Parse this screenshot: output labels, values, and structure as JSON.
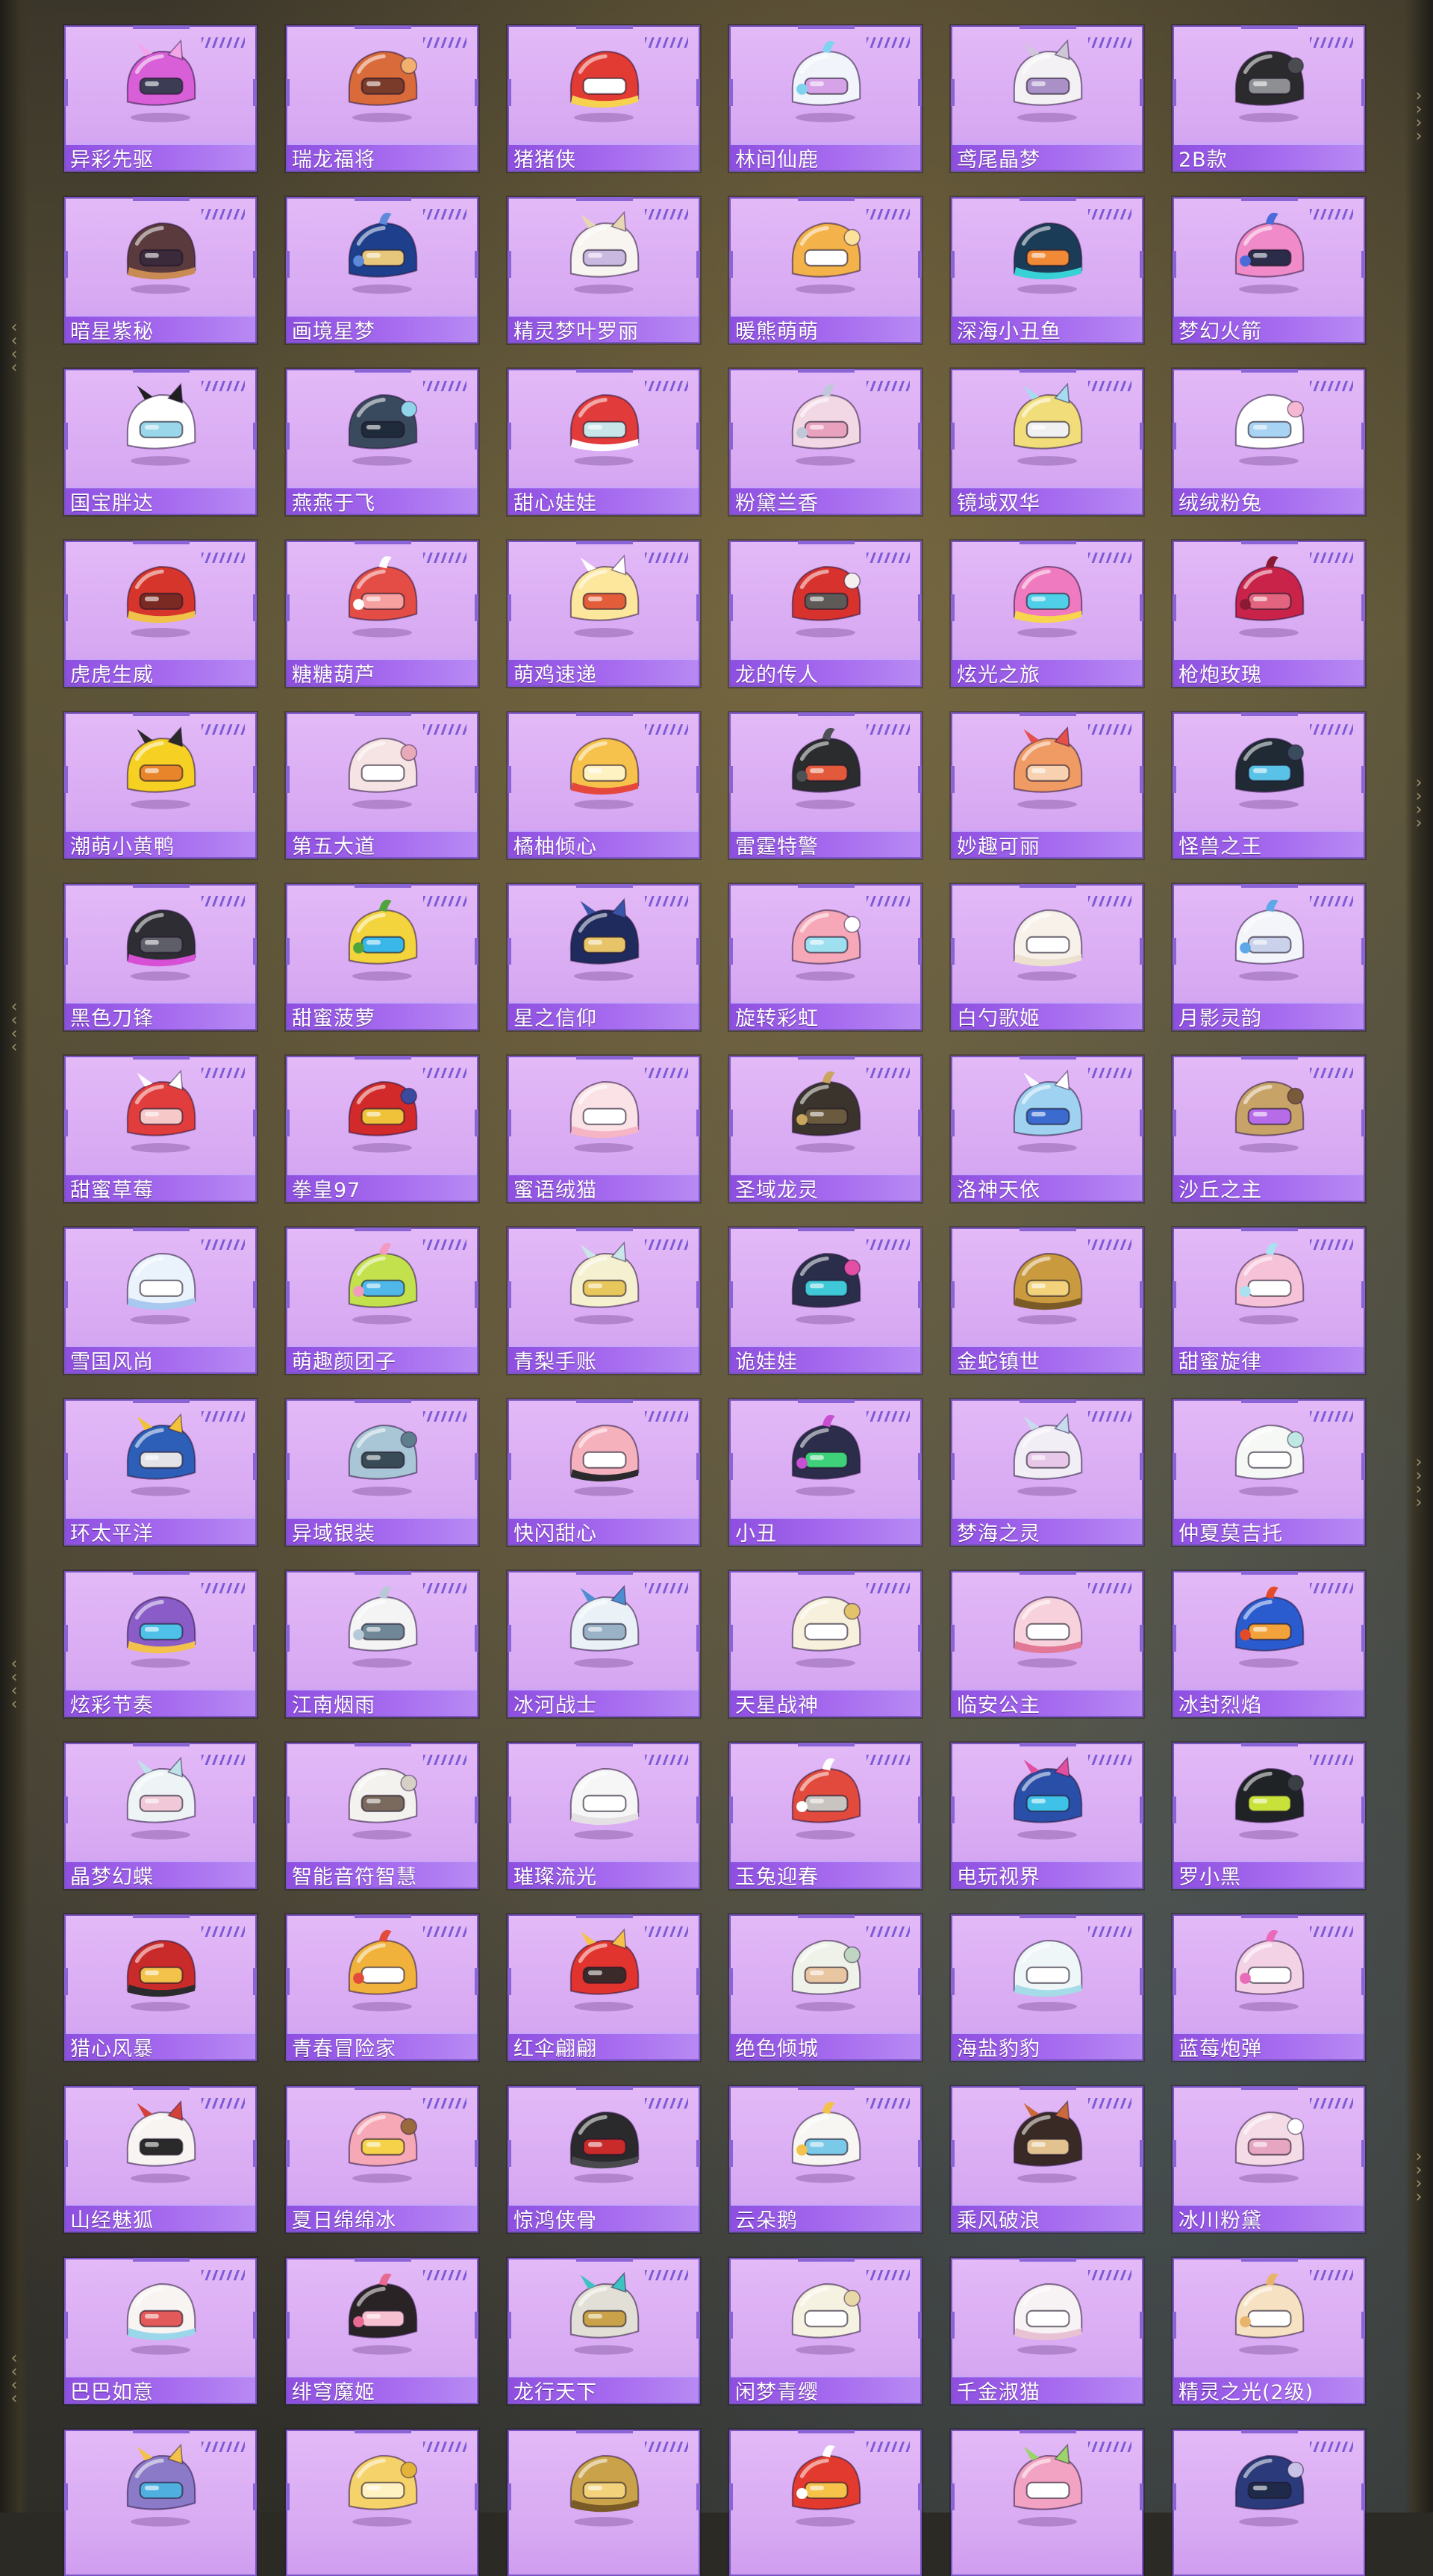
{
  "items": [
    {
      "name": "异彩先驱",
      "icon": "cyber-helmet-icon",
      "colors": [
        "#d85fd8",
        "#f2a5e8",
        "#3c3c55"
      ]
    },
    {
      "name": "瑞龙福将",
      "icon": "dragon-helmet-icon",
      "colors": [
        "#d96a3a",
        "#f1b06d",
        "#7a3b2a"
      ]
    },
    {
      "name": "猪猪侠",
      "icon": "pig-helmet-icon",
      "colors": [
        "#e23b33",
        "#f6d24f",
        "#ffffff"
      ]
    },
    {
      "name": "林间仙鹿",
      "icon": "deer-helmet-icon",
      "colors": [
        "#f1f4fb",
        "#7fd3ee",
        "#d6a3e8"
      ]
    },
    {
      "name": "鸢尾晶梦",
      "icon": "iris-helmet-icon",
      "colors": [
        "#f4f1f4",
        "#cfc6d8",
        "#a991c8"
      ]
    },
    {
      "name": "2B款",
      "icon": "black-helmet-icon",
      "colors": [
        "#2b2b2d",
        "#4a4c4f",
        "#8d8f92"
      ]
    },
    {
      "name": "暗星紫秘",
      "icon": "dark-star-helmet-icon",
      "colors": [
        "#5a3a3c",
        "#c98a54",
        "#3a2a3a"
      ]
    },
    {
      "name": "画境星梦",
      "icon": "painted-helmet-icon",
      "colors": [
        "#1d3f8c",
        "#5d8ad9",
        "#e7c77c"
      ]
    },
    {
      "name": "精灵梦叶罗丽",
      "icon": "fairy-helmet-icon",
      "colors": [
        "#f8f4f0",
        "#e7d6b4",
        "#c9b8e0"
      ]
    },
    {
      "name": "暖熊萌萌",
      "icon": "bear-helmet-icon",
      "colors": [
        "#f3b24a",
        "#fbe19b",
        "#ffffff"
      ]
    },
    {
      "name": "深海小丑鱼",
      "icon": "clownfish-helmet-icon",
      "colors": [
        "#1b3c57",
        "#37d1d6",
        "#f08a36"
      ]
    },
    {
      "name": "梦幻火箭",
      "icon": "rocket-helmet-icon",
      "colors": [
        "#f08ac8",
        "#4a6bd8",
        "#2b2b4a"
      ]
    },
    {
      "name": "国宝胖达",
      "icon": "panda-helmet-icon",
      "colors": [
        "#ffffff",
        "#1f1f22",
        "#9ad7ea"
      ]
    },
    {
      "name": "燕燕于飞",
      "icon": "swallow-helmet-icon",
      "colors": [
        "#3a4a5e",
        "#8fd4e8",
        "#1f2a3a"
      ]
    },
    {
      "name": "甜心娃娃",
      "icon": "santa-helmet-icon",
      "colors": [
        "#e23b3b",
        "#ffffff",
        "#c8e6ea"
      ]
    },
    {
      "name": "粉黛兰香",
      "icon": "orchid-helmet-icon",
      "colors": [
        "#f2d7e4",
        "#bfc8d6",
        "#e9a2be"
      ]
    },
    {
      "name": "镜域双华",
      "icon": "mirror-helmet-icon",
      "colors": [
        "#f1dd7a",
        "#a5dcf0",
        "#f0f0f0"
      ]
    },
    {
      "name": "绒绒粉兔",
      "icon": "bunny-helmet-icon",
      "colors": [
        "#ffffff",
        "#f4b8d2",
        "#a9d3f2"
      ]
    },
    {
      "name": "虎虎生威",
      "icon": "tiger-helmet-icon",
      "colors": [
        "#d6352b",
        "#f0c24a",
        "#7a2a22"
      ]
    },
    {
      "name": "糖糖葫芦",
      "icon": "candied-haw-helmet-icon",
      "colors": [
        "#e44d45",
        "#ffffff",
        "#f6a0a0"
      ]
    },
    {
      "name": "萌鸡速递",
      "icon": "chick-helmet-icon",
      "colors": [
        "#fde79c",
        "#ffffff",
        "#e45d3b"
      ]
    },
    {
      "name": "龙的传人",
      "icon": "dragon-heir-helmet-icon",
      "colors": [
        "#d8322e",
        "#f3f0ee",
        "#5d5a58"
      ]
    },
    {
      "name": "炫光之旅",
      "icon": "neon-helmet-icon",
      "colors": [
        "#f07ac0",
        "#f7d54d",
        "#4fd0e8"
      ]
    },
    {
      "name": "枪炮玫瑰",
      "icon": "rose-helmet-icon",
      "colors": [
        "#c9234a",
        "#8a1a33",
        "#e2647e"
      ]
    },
    {
      "name": "潮萌小黄鸭",
      "icon": "duck-helmet-icon",
      "colors": [
        "#f6d124",
        "#2a2a2a",
        "#e8852b"
      ]
    },
    {
      "name": "第五大道",
      "icon": "fifth-avenue-helmet-icon",
      "colors": [
        "#f6e3e3",
        "#e8a9b8",
        "#ffffff"
      ]
    },
    {
      "name": "橘柚倾心",
      "icon": "citrus-helmet-icon",
      "colors": [
        "#f7c24b",
        "#e5473d",
        "#fff2c2"
      ]
    },
    {
      "name": "雷霆特警",
      "icon": "swat-helmet-icon",
      "colors": [
        "#2a2c2e",
        "#4e5256",
        "#e25a3b"
      ]
    },
    {
      "name": "妙趣可丽",
      "icon": "crepe-helmet-icon",
      "colors": [
        "#f09a64",
        "#e5504a",
        "#f8d2b0"
      ]
    },
    {
      "name": "怪兽之王",
      "icon": "kaiju-helmet-icon",
      "colors": [
        "#1f2a35",
        "#3a4b5e",
        "#59c2e6"
      ]
    },
    {
      "name": "黑色刀锋",
      "icon": "blade-helmet-icon",
      "colors": [
        "#2d2d33",
        "#d64fd5",
        "#5e5e68"
      ]
    },
    {
      "name": "甜蜜菠萝",
      "icon": "pineapple-helmet-icon",
      "colors": [
        "#f3d43c",
        "#4fa53b",
        "#38b7e8"
      ]
    },
    {
      "name": "星之信仰",
      "icon": "star-faith-helmet-icon",
      "colors": [
        "#1f2b5c",
        "#3a55a8",
        "#e7c468"
      ]
    },
    {
      "name": "旋转彩虹",
      "icon": "rainbow-helmet-icon",
      "colors": [
        "#f6a8b8",
        "#ffffff",
        "#9ee0f0"
      ]
    },
    {
      "name": "白勺歌姬",
      "icon": "singer-helmet-icon",
      "colors": [
        "#f7f1ea",
        "#ece0cf",
        "#ffffff"
      ]
    },
    {
      "name": "月影灵韵",
      "icon": "moon-helmet-icon",
      "colors": [
        "#f4f4fb",
        "#5ea8e8",
        "#c9d2ea"
      ]
    },
    {
      "name": "甜蜜草莓",
      "icon": "strawberry-helmet-icon",
      "colors": [
        "#e23d3d",
        "#ffffff",
        "#f6c8c8"
      ]
    },
    {
      "name": "拳皇97",
      "icon": "kof97-helmet-icon",
      "colors": [
        "#d22a2a",
        "#3b4a9e",
        "#f0c23a"
      ]
    },
    {
      "name": "蜜语绒猫",
      "icon": "plush-cat-helmet-icon",
      "colors": [
        "#fbe2e7",
        "#f5b5c4",
        "#ffffff"
      ]
    },
    {
      "name": "圣域龙灵",
      "icon": "sanctuary-dragon-helmet-icon",
      "colors": [
        "#3a342c",
        "#c9a55e",
        "#6a5a3e"
      ]
    },
    {
      "name": "洛神天依",
      "icon": "luo-tianyi-helmet-icon",
      "colors": [
        "#9fd2f0",
        "#ffffff",
        "#3b6bcf"
      ]
    },
    {
      "name": "沙丘之主",
      "icon": "dune-helmet-icon",
      "colors": [
        "#c8a368",
        "#7a5a3a",
        "#b66be8"
      ]
    },
    {
      "name": "雪国风尚",
      "icon": "snow-helmet-icon",
      "colors": [
        "#eaf2fb",
        "#a9c8ef",
        "#ffffff"
      ]
    },
    {
      "name": "萌趣颜团子",
      "icon": "dango-helmet-icon",
      "colors": [
        "#c3e14d",
        "#f29ac0",
        "#4fb8e8"
      ]
    },
    {
      "name": "青梨手账",
      "icon": "pear-helmet-icon",
      "colors": [
        "#f4f0d0",
        "#c9e6e9",
        "#e8c85c"
      ]
    },
    {
      "name": "诡娃娃",
      "icon": "creepy-doll-helmet-icon",
      "colors": [
        "#2a2e4a",
        "#e24fa5",
        "#3fc9d8"
      ]
    },
    {
      "name": "金蛇镇世",
      "icon": "golden-snake-helmet-icon",
      "colors": [
        "#c99a3e",
        "#7a5a26",
        "#f2d27a"
      ]
    },
    {
      "name": "甜蜜旋律",
      "icon": "melody-helmet-icon",
      "colors": [
        "#f6c2d8",
        "#a8e2f0",
        "#ffffff"
      ]
    },
    {
      "name": "环太平洋",
      "icon": "pacific-rim-helmet-icon",
      "colors": [
        "#2d5fb8",
        "#f2c23a",
        "#e4e4e8"
      ]
    },
    {
      "name": "异域银装",
      "icon": "silver-helmet-icon",
      "colors": [
        "#a9c6d6",
        "#5e7e8e",
        "#3a4b58"
      ]
    },
    {
      "name": "快闪甜心",
      "icon": "flash-sweet-helmet-icon",
      "colors": [
        "#f6b2bc",
        "#2b2b2d",
        "#ffffff"
      ]
    },
    {
      "name": "小丑",
      "icon": "joker-helmet-icon",
      "colors": [
        "#2b2d4a",
        "#c94fd2",
        "#3fd07a"
      ]
    },
    {
      "name": "梦海之灵",
      "icon": "dream-sea-helmet-icon",
      "colors": [
        "#f2eef6",
        "#c7dcef",
        "#e8c8e8"
      ]
    },
    {
      "name": "仲夏莫吉托",
      "icon": "mojito-helmet-icon",
      "colors": [
        "#f6f8f6",
        "#bfe7e3",
        "#ffffff"
      ]
    },
    {
      "name": "炫彩节奏",
      "icon": "rhythm-helmet-icon",
      "colors": [
        "#8a5cc8",
        "#f2c24a",
        "#4fc0e8"
      ]
    },
    {
      "name": "江南烟雨",
      "icon": "jiangnan-helmet-icon",
      "colors": [
        "#f4f4f4",
        "#b6c9d6",
        "#6f8796"
      ]
    },
    {
      "name": "冰河战士",
      "icon": "glacier-helmet-icon",
      "colors": [
        "#eaf2f8",
        "#4b8fd2",
        "#9ab2c6"
      ]
    },
    {
      "name": "天星战神",
      "icon": "star-god-helmet-icon",
      "colors": [
        "#f6f0dc",
        "#e2c26a",
        "#ffffff"
      ]
    },
    {
      "name": "临安公主",
      "icon": "princess-helmet-icon",
      "colors": [
        "#f7d2dc",
        "#e27896",
        "#ffffff"
      ]
    },
    {
      "name": "冰封烈焰",
      "icon": "frozen-flame-helmet-icon",
      "colors": [
        "#2a5cd0",
        "#e24a2a",
        "#f2a23a"
      ]
    },
    {
      "name": "晶梦幻蝶",
      "icon": "butterfly-helmet-icon",
      "colors": [
        "#eef4f6",
        "#bfe2e8",
        "#f0c8d8"
      ]
    },
    {
      "name": "智能音符智慧",
      "icon": "music-note-helmet-icon",
      "colors": [
        "#f4f2ee",
        "#d6d0c6",
        "#7a6a5e"
      ]
    },
    {
      "name": "璀璨流光",
      "icon": "radiant-helmet-icon",
      "colors": [
        "#f7f6f6",
        "#e4e0e4",
        "#ffffff"
      ]
    },
    {
      "name": "玉兔迎春",
      "icon": "jade-rabbit-helmet-icon",
      "colors": [
        "#e24a3e",
        "#ffffff",
        "#c9c4c0"
      ]
    },
    {
      "name": "电玩视界",
      "icon": "arcade-helmet-icon",
      "colors": [
        "#2a4fa8",
        "#e24fa0",
        "#3fc2e8"
      ]
    },
    {
      "name": "罗小黑",
      "icon": "black-cat-helmet-icon",
      "colors": [
        "#1f2326",
        "#3a3f44",
        "#c9e23a"
      ]
    },
    {
      "name": "猎心风暴",
      "icon": "storm-helmet-icon",
      "colors": [
        "#c92a2a",
        "#2b2b2d",
        "#f2c24a"
      ]
    },
    {
      "name": "青春冒险家",
      "icon": "adventurer-helmet-icon",
      "colors": [
        "#f0b23a",
        "#e24a3a",
        "#ffffff"
      ]
    },
    {
      "name": "红伞翩翩",
      "icon": "umbrella-helmet-icon",
      "colors": [
        "#e2342e",
        "#f6c24a",
        "#3a2a2a"
      ]
    },
    {
      "name": "绝色倾城",
      "icon": "beauty-helmet-icon",
      "colors": [
        "#eef2e8",
        "#bfd6c2",
        "#e8c6a2"
      ]
    },
    {
      "name": "海盐豹豹",
      "icon": "sea-salt-leopard-helmet-icon",
      "colors": [
        "#eef6f8",
        "#a6dce8",
        "#ffffff"
      ]
    },
    {
      "name": "蓝莓炮弹",
      "icon": "blueberry-helmet-icon",
      "colors": [
        "#f4d2e6",
        "#e86ab8",
        "#ffffff"
      ]
    },
    {
      "name": "山经魅狐",
      "icon": "fox-mask-helmet-icon",
      "colors": [
        "#f7f4f2",
        "#d2423a",
        "#2a2a2a"
      ]
    },
    {
      "name": "夏日绵绵冰",
      "icon": "shaved-ice-helmet-icon",
      "colors": [
        "#f6a8b6",
        "#9a6a3e",
        "#f6d24a"
      ]
    },
    {
      "name": "惊鸿侠骨",
      "icon": "swordsman-helmet-icon",
      "colors": [
        "#2a2a2c",
        "#4a4a4e",
        "#c92a2a"
      ]
    },
    {
      "name": "云朵鹅",
      "icon": "goose-helmet-icon",
      "colors": [
        "#f7f6f2",
        "#f2c24a",
        "#7ac9e8"
      ]
    },
    {
      "name": "乘风破浪",
      "icon": "wave-rider-helmet-icon",
      "colors": [
        "#3a2a26",
        "#c96a3a",
        "#e2c28e"
      ]
    },
    {
      "name": "冰川粉黛",
      "icon": "glacier-pink-helmet-icon",
      "colors": [
        "#f4dbe6",
        "#ffffff",
        "#e6a6c2"
      ]
    },
    {
      "name": "巴巴如意",
      "icon": "ruyi-helmet-icon",
      "colors": [
        "#f7f4f2",
        "#9ad7ea",
        "#e25a5a"
      ]
    },
    {
      "name": "绯穹魔姬",
      "icon": "demon-princess-helmet-icon",
      "colors": [
        "#2a2326",
        "#e86a92",
        "#f6c2d2"
      ]
    },
    {
      "name": "龙行天下",
      "icon": "dragon-walk-helmet-icon",
      "colors": [
        "#e2e0d6",
        "#3fc2c2",
        "#c9a24a"
      ]
    },
    {
      "name": "闲梦青缨",
      "icon": "tassel-helmet-icon",
      "colors": [
        "#f6f2e2",
        "#e8d8a8",
        "#ffffff"
      ]
    },
    {
      "name": "千金淑猫",
      "icon": "lady-cat-helmet-icon",
      "colors": [
        "#f7f2f4",
        "#e8c2d2",
        "#ffffff"
      ]
    },
    {
      "name": "精灵之光(2级)",
      "icon": "fairy-light-helmet-icon",
      "colors": [
        "#f6e2c2",
        "#e8b46a",
        "#ffffff"
      ]
    },
    {
      "name": "",
      "icon": "rainbow-cap-helmet-icon",
      "colors": [
        "#8a7ac8",
        "#f2c24a",
        "#4fb0e0"
      ]
    },
    {
      "name": "",
      "icon": "gold-dome-helmet-icon",
      "colors": [
        "#f6d26a",
        "#e2b23a",
        "#fff2c2"
      ]
    },
    {
      "name": "",
      "icon": "golden-crest-helmet-icon",
      "colors": [
        "#c9a24a",
        "#7a5a26",
        "#f2d27a"
      ]
    },
    {
      "name": "",
      "icon": "red-white-helmet-icon",
      "colors": [
        "#e23a2e",
        "#ffffff",
        "#f6c24a"
      ]
    },
    {
      "name": "",
      "icon": "pink-bulb-helmet-icon",
      "colors": [
        "#f2a2c2",
        "#9ad46a",
        "#ffffff"
      ]
    },
    {
      "name": "",
      "icon": "navy-helmet-icon",
      "colors": [
        "#2a3a7a",
        "#c9c2e8",
        "#1f2a4a"
      ]
    }
  ]
}
